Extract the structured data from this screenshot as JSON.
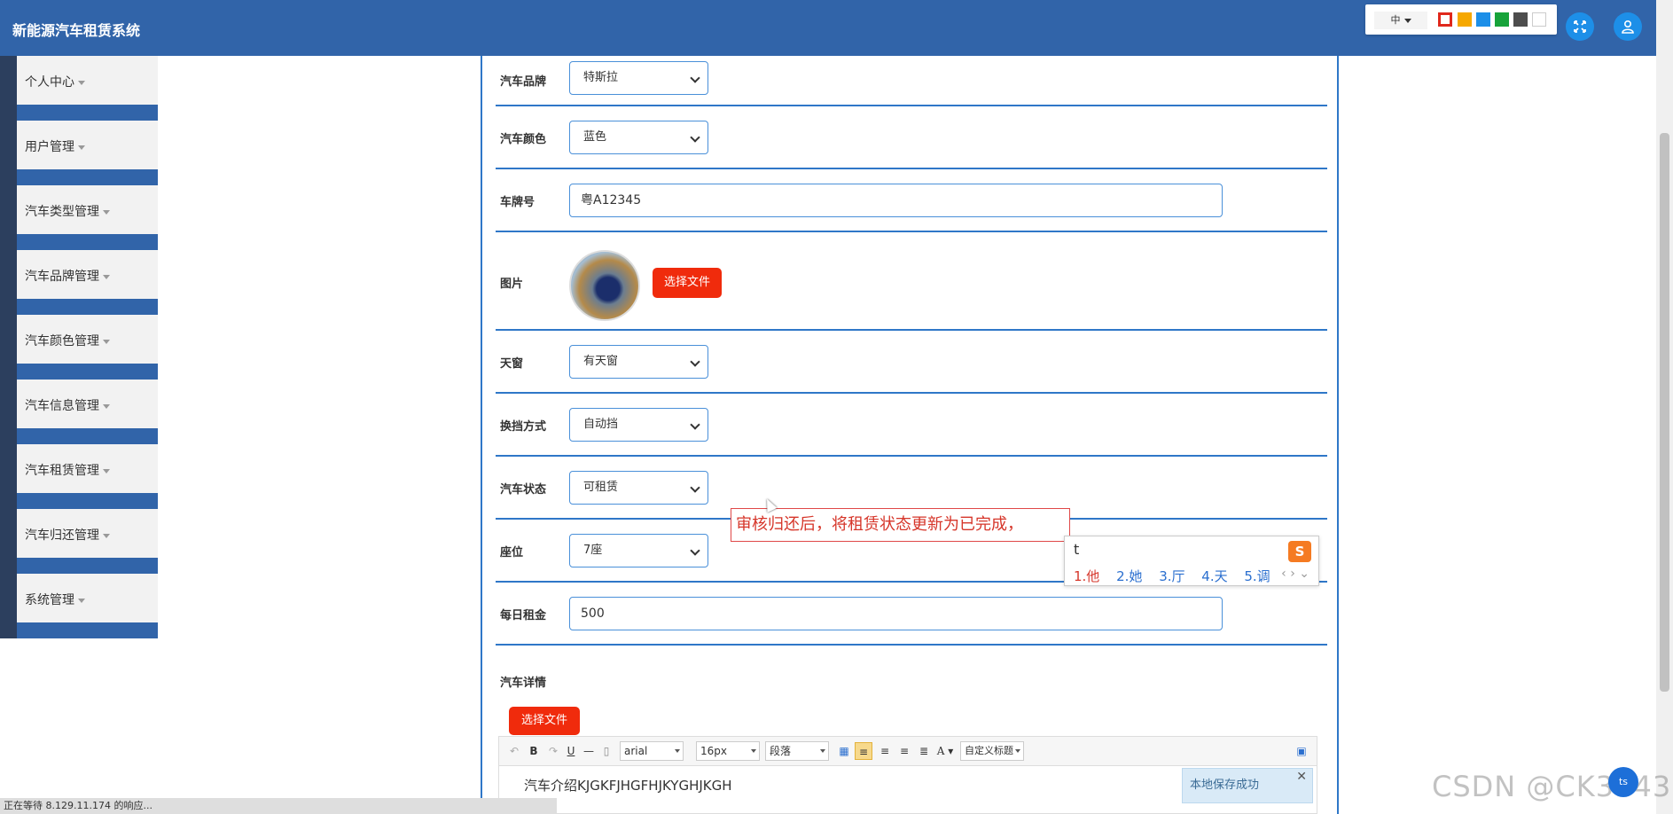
{
  "header": {
    "title": "新能源汽车租赁系统",
    "lang": "中",
    "theme_colors": [
      "#e0281c",
      "#f6a800",
      "#1d8fe8",
      "#17a33a",
      "#4d4d4d",
      "#ffffff"
    ]
  },
  "sidebar": {
    "items": [
      {
        "label": "个人中心"
      },
      {
        "label": "用户管理"
      },
      {
        "label": "汽车类型管理"
      },
      {
        "label": "汽车品牌管理"
      },
      {
        "label": "汽车颜色管理"
      },
      {
        "label": "汽车信息管理"
      },
      {
        "label": "汽车租赁管理"
      },
      {
        "label": "汽车归还管理"
      },
      {
        "label": "系统管理"
      }
    ]
  },
  "form": {
    "brand": {
      "label": "汽车品牌",
      "value": "特斯拉"
    },
    "color": {
      "label": "汽车颜色",
      "value": "蓝色"
    },
    "plate": {
      "label": "车牌号",
      "value": "粤A12345"
    },
    "image": {
      "label": "图片",
      "button": "选择文件"
    },
    "sunroof": {
      "label": "天窗",
      "value": "有天窗"
    },
    "gear": {
      "label": "换挡方式",
      "value": "自动挡"
    },
    "status": {
      "label": "汽车状态",
      "value": "可租赁"
    },
    "seats": {
      "label": "座位",
      "value": "7座"
    },
    "rent": {
      "label": "每日租金",
      "value": "500"
    },
    "details": {
      "label": "汽车详情",
      "button": "选择文件"
    }
  },
  "ime": {
    "composition": "审核归还后，将租赁状态更新为已完成，",
    "typed": "t",
    "candidates": [
      "1.他",
      "2.她",
      "3.厅",
      "4.天",
      "5.调"
    ]
  },
  "editor": {
    "font_family": "arial",
    "font_size": "16px",
    "paragraph": "段落",
    "custom_title": "自定义标题",
    "content": "汽车介绍KJGKFJHGFHJKYGHJKGH",
    "toast": "本地保存成功"
  },
  "status_bar": "正在等待 8.129.11.174 的响应...",
  "watermark": "CSDN @CK3043",
  "chat_label": "ts"
}
